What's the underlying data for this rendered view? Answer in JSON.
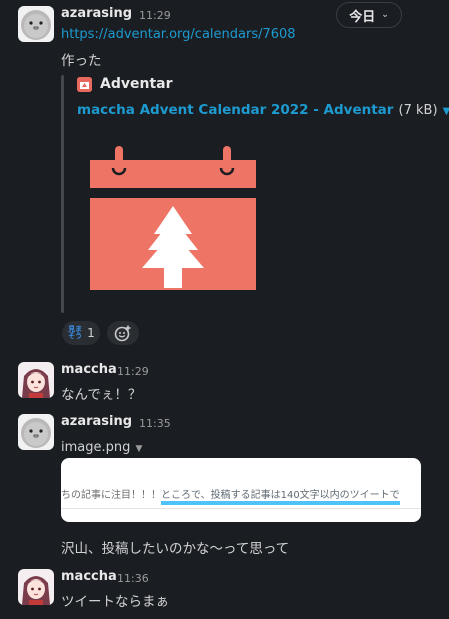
{
  "date_divider": {
    "label": "今日"
  },
  "messages": [
    {
      "user": "azarasing",
      "time": "11:29",
      "link": "https://adventar.org/calendars/7608",
      "text": "作った",
      "attachment": {
        "site": "Adventar",
        "title": "maccha Advent Calendar 2022 - Adventar",
        "size": "(7 kB)"
      },
      "reaction": {
        "emoji_text": "見まそう",
        "count": "1"
      }
    },
    {
      "user": "maccha",
      "time": "11:29",
      "text": "なんでぇ！？"
    },
    {
      "user": "azarasing",
      "time": "11:35",
      "file": {
        "name": "image.png",
        "preview_text_plain": "ちの記事に注目！！！",
        "preview_text_highlight": "ところで、投稿する記事は140文字以内のツイートで"
      },
      "text": "沢山、投稿したいのかな〜って思って"
    },
    {
      "user": "maccha",
      "time": "11:36",
      "text": "ツイートならまぁ"
    }
  ],
  "colors": {
    "background": "#1a1d21",
    "link": "#1d9bd1",
    "adventar": "#e8695d",
    "highlight": "#4fc3f7"
  }
}
